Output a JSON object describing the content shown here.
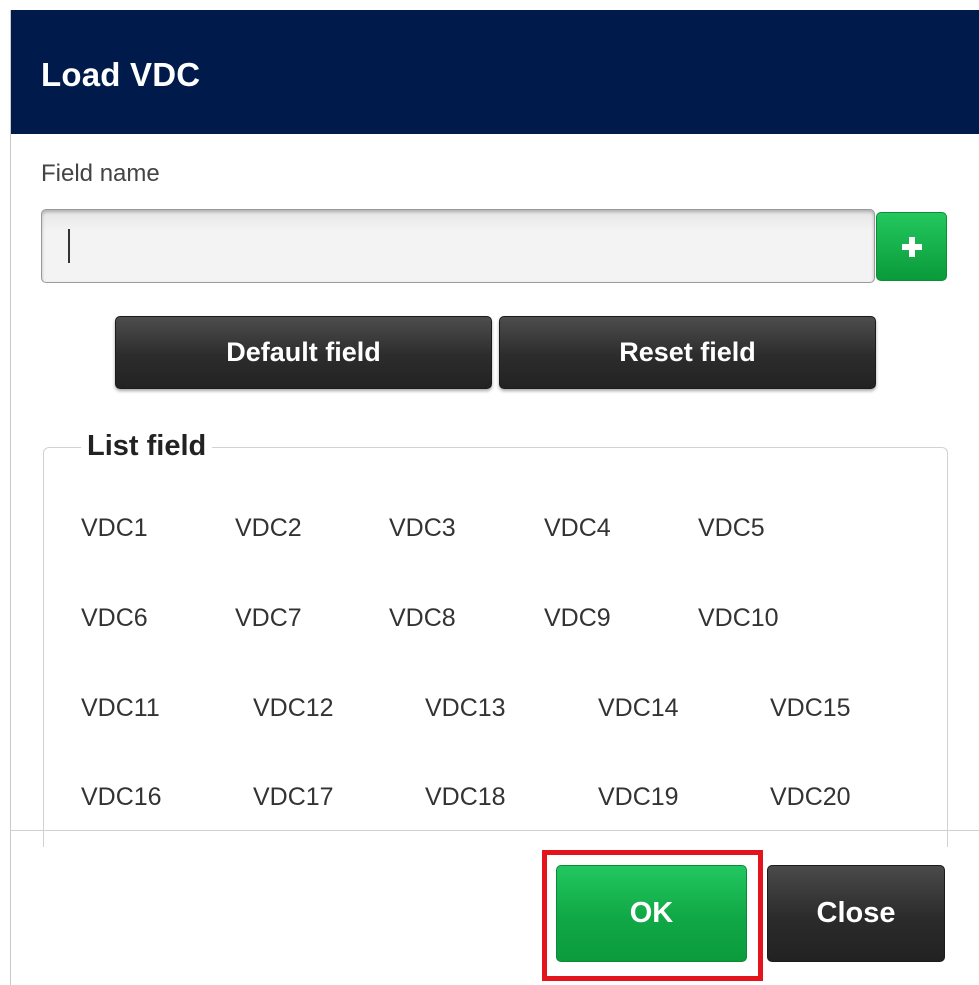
{
  "dialog": {
    "title": "Load VDC"
  },
  "field": {
    "label": "Field name",
    "value": "",
    "placeholder": ""
  },
  "actions": {
    "default_field": "Default field",
    "reset_field": "Reset field"
  },
  "list": {
    "legend": "List field",
    "items": [
      "VDC1",
      "VDC2",
      "VDC3",
      "VDC4",
      "VDC5",
      "VDC6",
      "VDC7",
      "VDC8",
      "VDC9",
      "VDC10",
      "VDC11",
      "VDC12",
      "VDC13",
      "VDC14",
      "VDC15",
      "VDC16",
      "VDC17",
      "VDC18",
      "VDC19",
      "VDC20"
    ]
  },
  "footer": {
    "ok": "OK",
    "close": "Close"
  },
  "colors": {
    "header_bg": "#001b4b",
    "ok_green": "#10a846",
    "highlight_red": "#e3141c"
  },
  "icons": {
    "add": "plus-icon"
  }
}
